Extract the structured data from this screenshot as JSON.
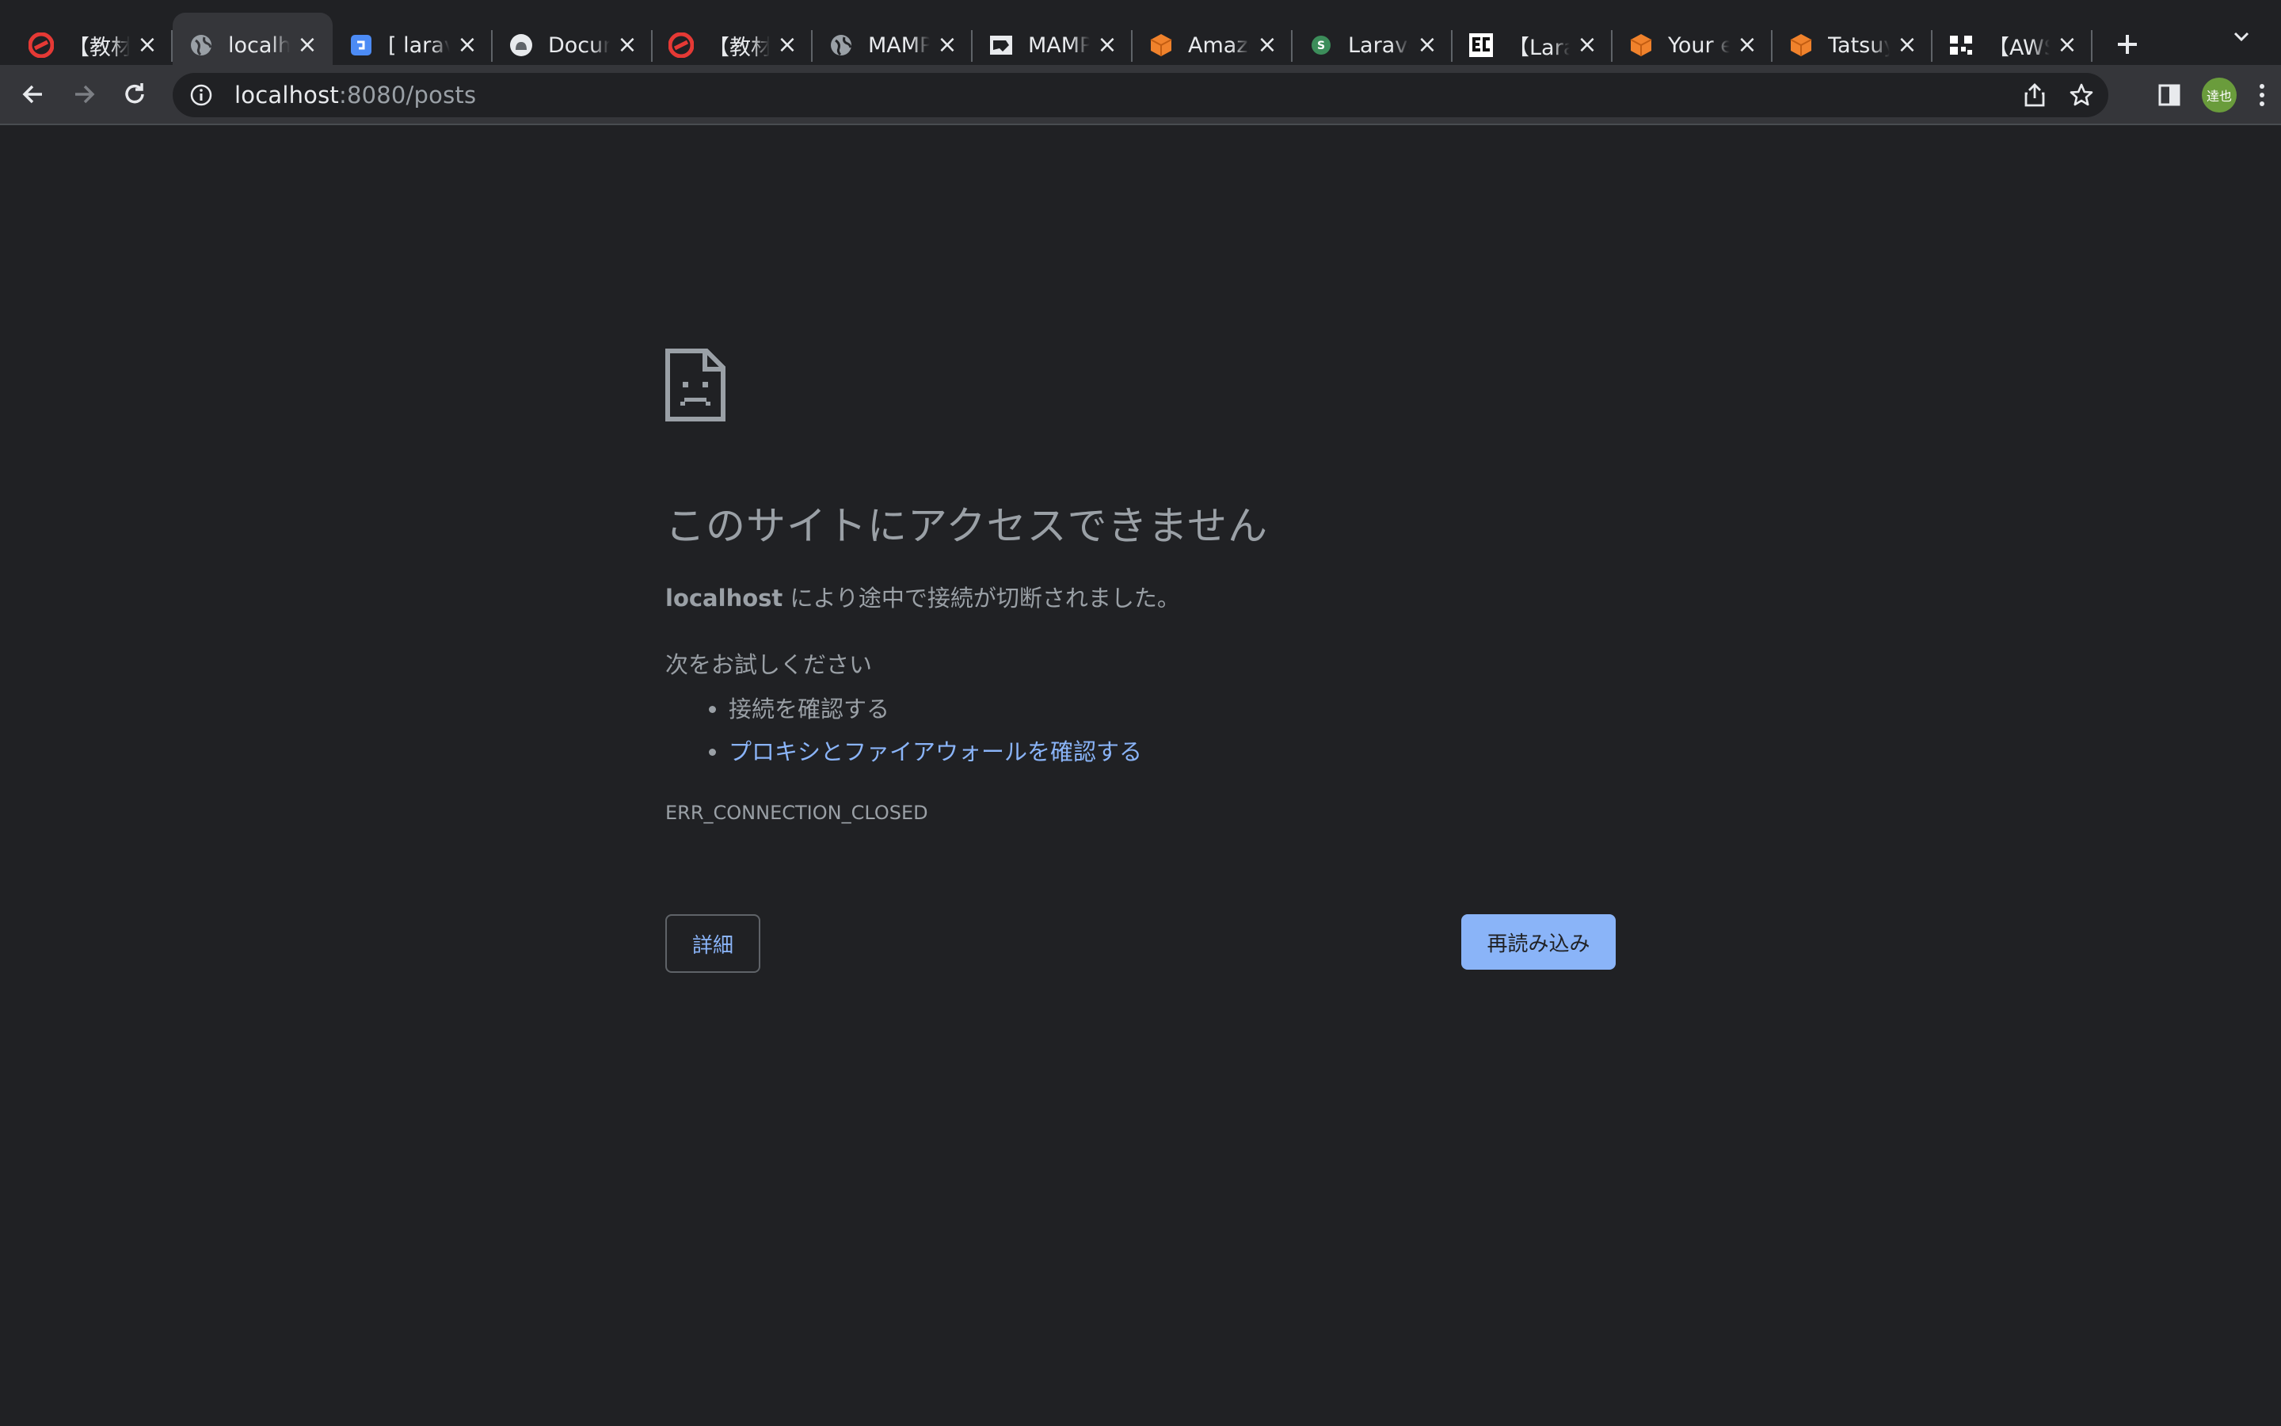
{
  "tabs": [
    {
      "title": "【教材】",
      "favicon": "red-swirl-icon",
      "color": "#e53935",
      "active": false
    },
    {
      "title": "localhost",
      "favicon": "globe-icon",
      "color": "#9aa0a6",
      "active": true
    },
    {
      "title": "[ laravel",
      "favicon": "document-blue-icon",
      "color": "#4c8bf5",
      "active": false
    },
    {
      "title": "Document",
      "favicon": "cloud-icon",
      "color": "#9aa0a6",
      "active": false
    },
    {
      "title": "【教材】",
      "favicon": "red-swirl-icon",
      "color": "#e53935",
      "active": false
    },
    {
      "title": "MAMP",
      "favicon": "globe-icon",
      "color": "#9aa0a6",
      "active": false
    },
    {
      "title": "MAMP",
      "favicon": "mamp-elephant-icon",
      "color": "#dddddd",
      "active": false
    },
    {
      "title": "Amazon",
      "favicon": "orange-cube-icon",
      "color": "#f0822c",
      "active": false
    },
    {
      "title": "Laravel",
      "favicon": "green-circle-icon",
      "color": "#3c8d5a",
      "active": false
    },
    {
      "title": "【Lara",
      "favicon": "ec-logo-icon",
      "color": "#ffffff",
      "active": false
    },
    {
      "title": "Your e",
      "favicon": "orange-cube-icon",
      "color": "#f0822c",
      "active": false
    },
    {
      "title": "Tatsuy",
      "favicon": "orange-cube-icon",
      "color": "#f0822c",
      "active": false
    },
    {
      "title": "【AWS",
      "favicon": "qr-logo-icon",
      "color": "#ffffff",
      "active": false
    }
  ],
  "toolbar": {
    "url_host": "localhost",
    "url_rest": ":8080/posts",
    "avatar_label": "達也"
  },
  "error": {
    "heading": "このサイトにアクセスできません",
    "host": "localhost",
    "summary_rest": " により途中で接続が切断されました。",
    "try_label": "次をお試しください",
    "suggestions": [
      "接続を確認する",
      "プロキシとファイアウォールを確認する"
    ],
    "code": "ERR_CONNECTION_CLOSED",
    "details_label": "詳細",
    "reload_label": "再読み込み"
  },
  "colors": {
    "background": "#202124",
    "toolbar": "#35363a",
    "link": "#8ab4f8",
    "muted_text": "#9aa0a6"
  }
}
